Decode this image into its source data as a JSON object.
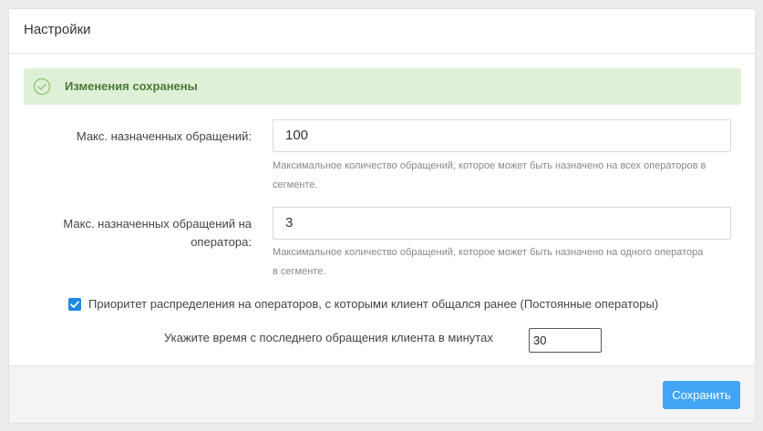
{
  "panel": {
    "title": "Настройки"
  },
  "alert": {
    "icon": "check-circle-icon",
    "text": "Изменения сохранены",
    "color": "#dff0d8"
  },
  "fields": {
    "max_assigned": {
      "label": "Макс. назначенных обращений:",
      "value": "100",
      "help": "Максимальное количество обращений, которое может быть назначено на всех операторов в сегменте."
    },
    "max_per_operator": {
      "label": "Макс. назначенных обращений на оператора:",
      "value": "3",
      "help": "Максимальное количество обращений, которое может быть назначено на одного оператора в сегменте."
    }
  },
  "priority_checkbox": {
    "checked": true,
    "label": "Приоритет распределения на операторов, с которыми клиент общался ранее (Постоянные операторы)"
  },
  "minutes": {
    "label": "Укажите время с последнего обращения клиента в минутах",
    "value": "30"
  },
  "footer": {
    "save_label": "Сохранить",
    "accent": "#42a5f5"
  }
}
